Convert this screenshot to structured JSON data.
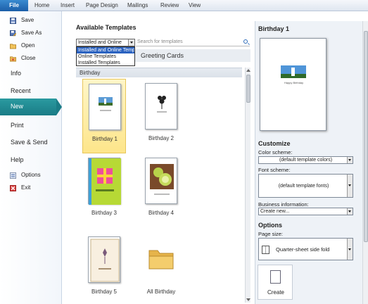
{
  "ribbon": {
    "tabs": [
      "File",
      "Home",
      "Insert",
      "Page Design",
      "Mailings",
      "Review",
      "View"
    ]
  },
  "nav": {
    "save": "Save",
    "save_as": "Save As",
    "open": "Open",
    "close": "Close",
    "info": "Info",
    "recent": "Recent",
    "new": "New",
    "print": "Print",
    "save_send": "Save & Send",
    "help": "Help",
    "options": "Options",
    "exit": "Exit"
  },
  "available": {
    "heading": "Available Templates",
    "source_value": "Installed and Online",
    "source_options": [
      "Installed and Online Templates",
      "Online Templates",
      "Installed Templates"
    ],
    "search_placeholder": "Search for templates",
    "breadcrumb": "Greeting Cards",
    "section": "Birthday",
    "templates": [
      "Birthday 1",
      "Birthday 2",
      "Birthday 3",
      "Birthday 4",
      "Birthday 5",
      "All Birthday"
    ],
    "selected": "Birthday 1"
  },
  "preview": {
    "title": "Birthday 1",
    "card_text": "Happy Birthday"
  },
  "customize": {
    "heading": "Customize",
    "color_label": "Color scheme:",
    "color_value": "(default template colors)",
    "font_label": "Font scheme:",
    "font_value": "(default template fonts)",
    "business_label": "Business information:",
    "business_value": "Create new..."
  },
  "options": {
    "heading": "Options",
    "page_size_label": "Page size:",
    "page_size_value": "Quarter-sheet side fold"
  },
  "create_label": "Create",
  "colors": {
    "accent": "#1a7c86",
    "selected_tile": "#fde58a",
    "file_tab": "#1b5ea8"
  }
}
